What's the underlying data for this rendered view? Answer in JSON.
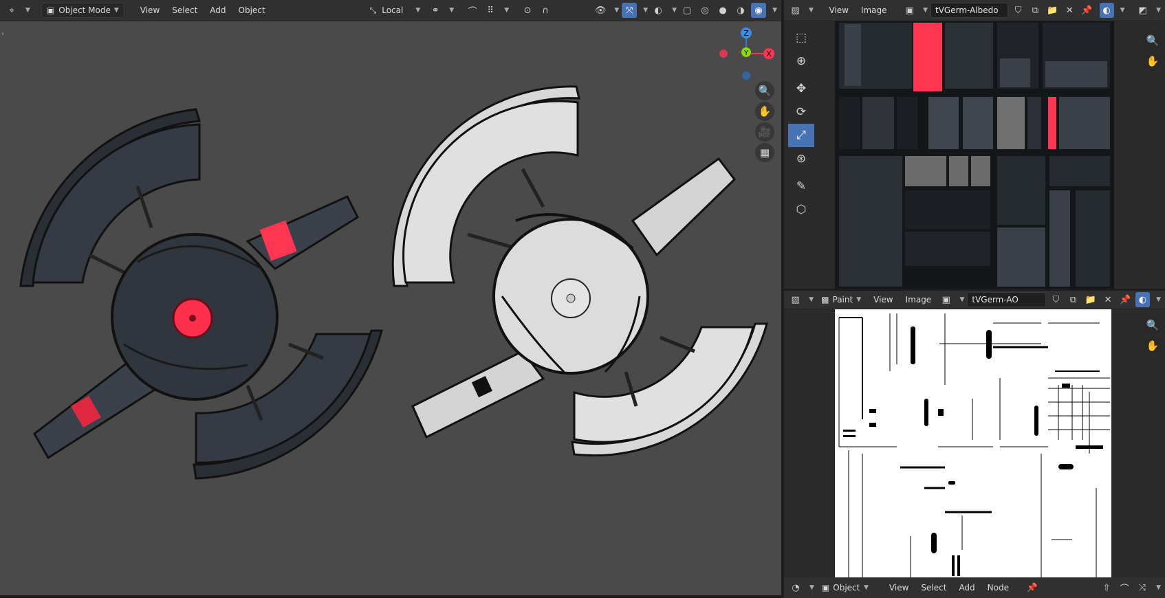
{
  "viewport": {
    "mode_label": "Object Mode",
    "menus": [
      "View",
      "Select",
      "Add",
      "Object"
    ],
    "transform_orientation": "Local",
    "gizmo_axes": {
      "z": "Z",
      "y": "Y",
      "x": "X"
    }
  },
  "image_editor_top": {
    "menus": [
      "View",
      "Image"
    ],
    "image_name": "tVGerm-Albedo"
  },
  "image_editor_bottom": {
    "mode_label": "Paint",
    "menus": [
      "View",
      "Image"
    ],
    "image_name": "tVGerm-AO"
  },
  "node_editor": {
    "object_label": "Object",
    "menus": [
      "View",
      "Select",
      "Add",
      "Node"
    ]
  },
  "colors": {
    "accent": "#4772b3",
    "highlight_red": "#ff3a55",
    "viewport_bg": "#4a4a4a",
    "header_bg": "#303030"
  },
  "icons": [
    "editor-type-icon",
    "object-mode-icon",
    "orientation-icon",
    "snap-icon",
    "proportional-icon",
    "overlay-icon",
    "xray-icon",
    "shading-wire-icon",
    "shading-solid-icon",
    "shading-material-icon",
    "shading-rendered-icon",
    "zoom-icon",
    "hand-icon",
    "camera-icon",
    "grid-icon",
    "select-box-icon",
    "cursor-icon",
    "move-icon",
    "rotate-icon",
    "scale-icon",
    "transform-icon",
    "annotate-icon",
    "add-cube-icon",
    "pin-icon",
    "new-image-icon",
    "open-image-icon",
    "close-icon",
    "fake-user-icon"
  ]
}
